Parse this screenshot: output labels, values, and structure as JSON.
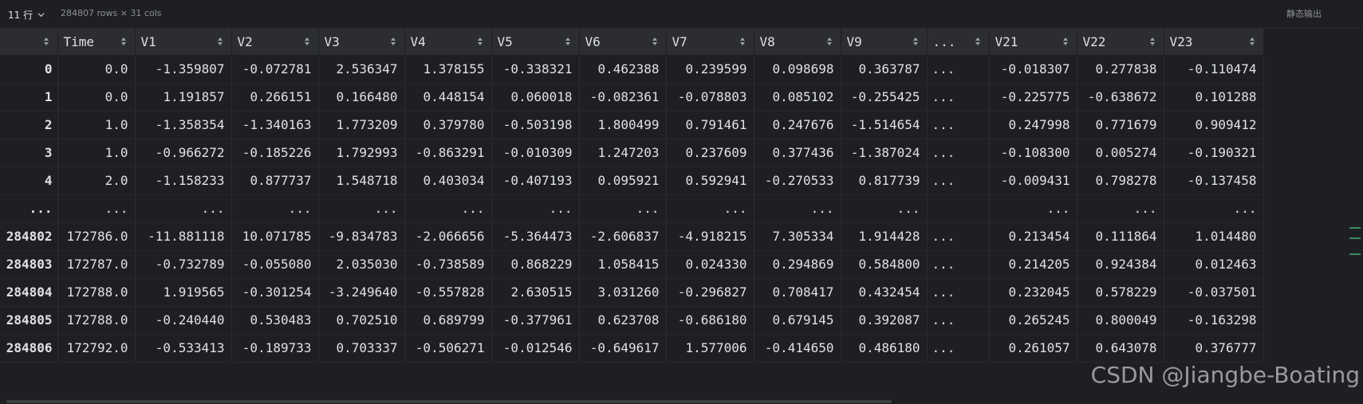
{
  "toolbar": {
    "rows_selector": "11 行",
    "shape_info": "284807 rows × 31 cols",
    "export_label": "静态输出"
  },
  "table": {
    "columns": [
      "",
      "Time",
      "V1",
      "V2",
      "V3",
      "V4",
      "V5",
      "V6",
      "V7",
      "V8",
      "V9",
      "...",
      "V21",
      "V22",
      "V23"
    ],
    "rows": [
      [
        "0",
        "0.0",
        "-1.359807",
        "-0.072781",
        "2.536347",
        "1.378155",
        "-0.338321",
        "0.462388",
        "0.239599",
        "0.098698",
        "0.363787",
        "...",
        "-0.018307",
        "0.277838",
        "-0.110474"
      ],
      [
        "1",
        "0.0",
        "1.191857",
        "0.266151",
        "0.166480",
        "0.448154",
        "0.060018",
        "-0.082361",
        "-0.078803",
        "0.085102",
        "-0.255425",
        "...",
        "-0.225775",
        "-0.638672",
        "0.101288"
      ],
      [
        "2",
        "1.0",
        "-1.358354",
        "-1.340163",
        "1.773209",
        "0.379780",
        "-0.503198",
        "1.800499",
        "0.791461",
        "0.247676",
        "-1.514654",
        "...",
        "0.247998",
        "0.771679",
        "0.909412"
      ],
      [
        "3",
        "1.0",
        "-0.966272",
        "-0.185226",
        "1.792993",
        "-0.863291",
        "-0.010309",
        "1.247203",
        "0.237609",
        "0.377436",
        "-1.387024",
        "...",
        "-0.108300",
        "0.005274",
        "-0.190321"
      ],
      [
        "4",
        "2.0",
        "-1.158233",
        "0.877737",
        "1.548718",
        "0.403034",
        "-0.407193",
        "0.095921",
        "0.592941",
        "-0.270533",
        "0.817739",
        "...",
        "-0.009431",
        "0.798278",
        "-0.137458"
      ],
      [
        "...",
        "...",
        "...",
        "...",
        "...",
        "...",
        "...",
        "...",
        "...",
        "...",
        "...",
        "",
        "...",
        "...",
        "..."
      ],
      [
        "284802",
        "172786.0",
        "-11.881118",
        "10.071785",
        "-9.834783",
        "-2.066656",
        "-5.364473",
        "-2.606837",
        "-4.918215",
        "7.305334",
        "1.914428",
        "...",
        "0.213454",
        "0.111864",
        "1.014480"
      ],
      [
        "284803",
        "172787.0",
        "-0.732789",
        "-0.055080",
        "2.035030",
        "-0.738589",
        "0.868229",
        "1.058415",
        "0.024330",
        "0.294869",
        "0.584800",
        "...",
        "0.214205",
        "0.924384",
        "0.012463"
      ],
      [
        "284804",
        "172788.0",
        "1.919565",
        "-0.301254",
        "-3.249640",
        "-0.557828",
        "2.630515",
        "3.031260",
        "-0.296827",
        "0.708417",
        "0.432454",
        "...",
        "0.232045",
        "0.578229",
        "-0.037501"
      ],
      [
        "284805",
        "172788.0",
        "-0.240440",
        "0.530483",
        "0.702510",
        "0.689799",
        "-0.377961",
        "0.623708",
        "-0.686180",
        "0.679145",
        "0.392087",
        "...",
        "0.265245",
        "0.800049",
        "-0.163298"
      ],
      [
        "284806",
        "172792.0",
        "-0.533413",
        "-0.189733",
        "0.703337",
        "-0.506271",
        "-0.012546",
        "-0.649617",
        "1.577006",
        "-0.414650",
        "0.486180",
        "...",
        "0.261057",
        "0.643078",
        "0.376777"
      ]
    ]
  },
  "watermark": "CSDN @Jiangbe-Boating",
  "colors": {
    "background": "#1e1f22",
    "header": "#2b2d30",
    "text": "#dfe1e5",
    "muted": "#8c8f94",
    "scroll_marker": "#3f8a5c"
  }
}
